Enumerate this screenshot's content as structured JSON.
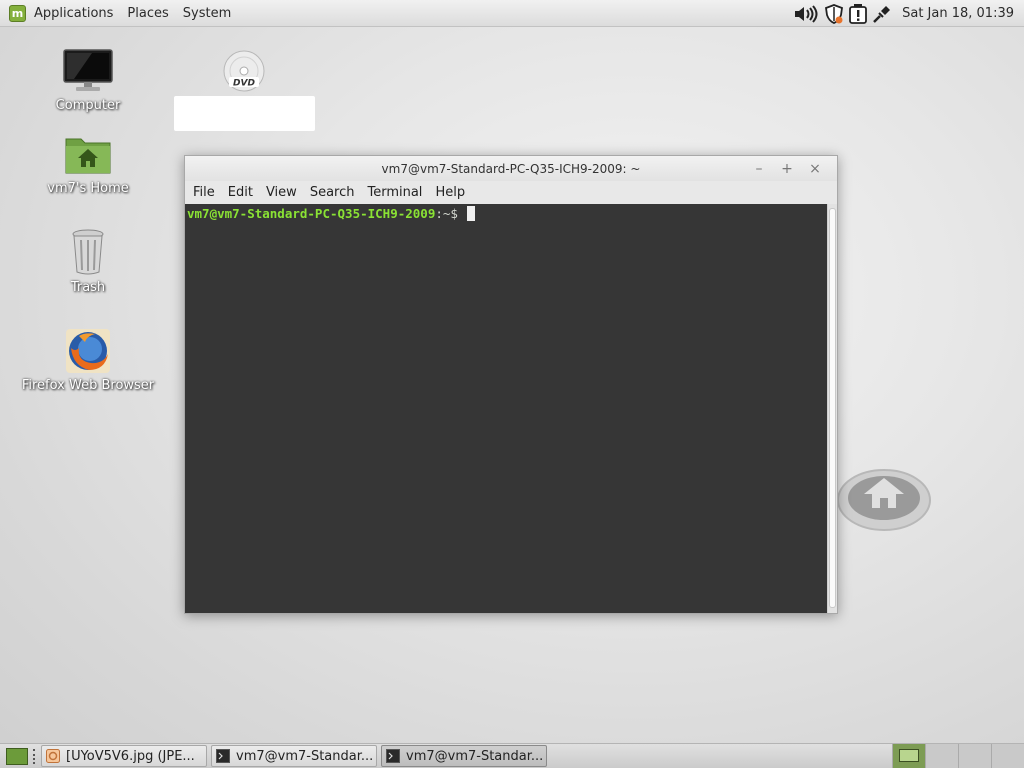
{
  "top_panel": {
    "menus": [
      "Applications",
      "Places",
      "System"
    ],
    "clock": "Sat Jan 18, 01:39"
  },
  "desktop": {
    "icons": [
      {
        "label": "Computer",
        "icon": "monitor-icon"
      },
      {
        "label": "vm7's Home",
        "icon": "home-folder-icon"
      },
      {
        "label": "Trash",
        "icon": "trash-icon"
      },
      {
        "label": "Firefox Web Browser",
        "icon": "firefox-icon"
      }
    ],
    "dvd": {
      "icon": "dvd-icon",
      "rename_value": ""
    }
  },
  "terminal": {
    "title": "vm7@vm7-Standard-PC-Q35-ICH9-2009: ~",
    "controls": {
      "minimize": "–",
      "maximize": "+",
      "close": "×"
    },
    "menus": [
      "File",
      "Edit",
      "View",
      "Search",
      "Terminal",
      "Help"
    ],
    "prompt_user": "vm7@vm7-Standard-PC-Q35-ICH9-2009",
    "prompt_suffix": ":~$ "
  },
  "taskbar": {
    "tasks": [
      {
        "label": "[UYoV5V6.jpg (JPE...",
        "icon": "image-viewer-icon",
        "active": false
      },
      {
        "label": "vm7@vm7-Standar...",
        "icon": "terminal-icon",
        "active": false
      },
      {
        "label": "vm7@vm7-Standar...",
        "icon": "terminal-icon",
        "active": true
      }
    ],
    "workspace_count": 4,
    "active_workspace": 1
  },
  "colors": {
    "prompt_green": "#8ae234",
    "terminal_bg": "#363636",
    "mint_green": "#84b03c"
  }
}
